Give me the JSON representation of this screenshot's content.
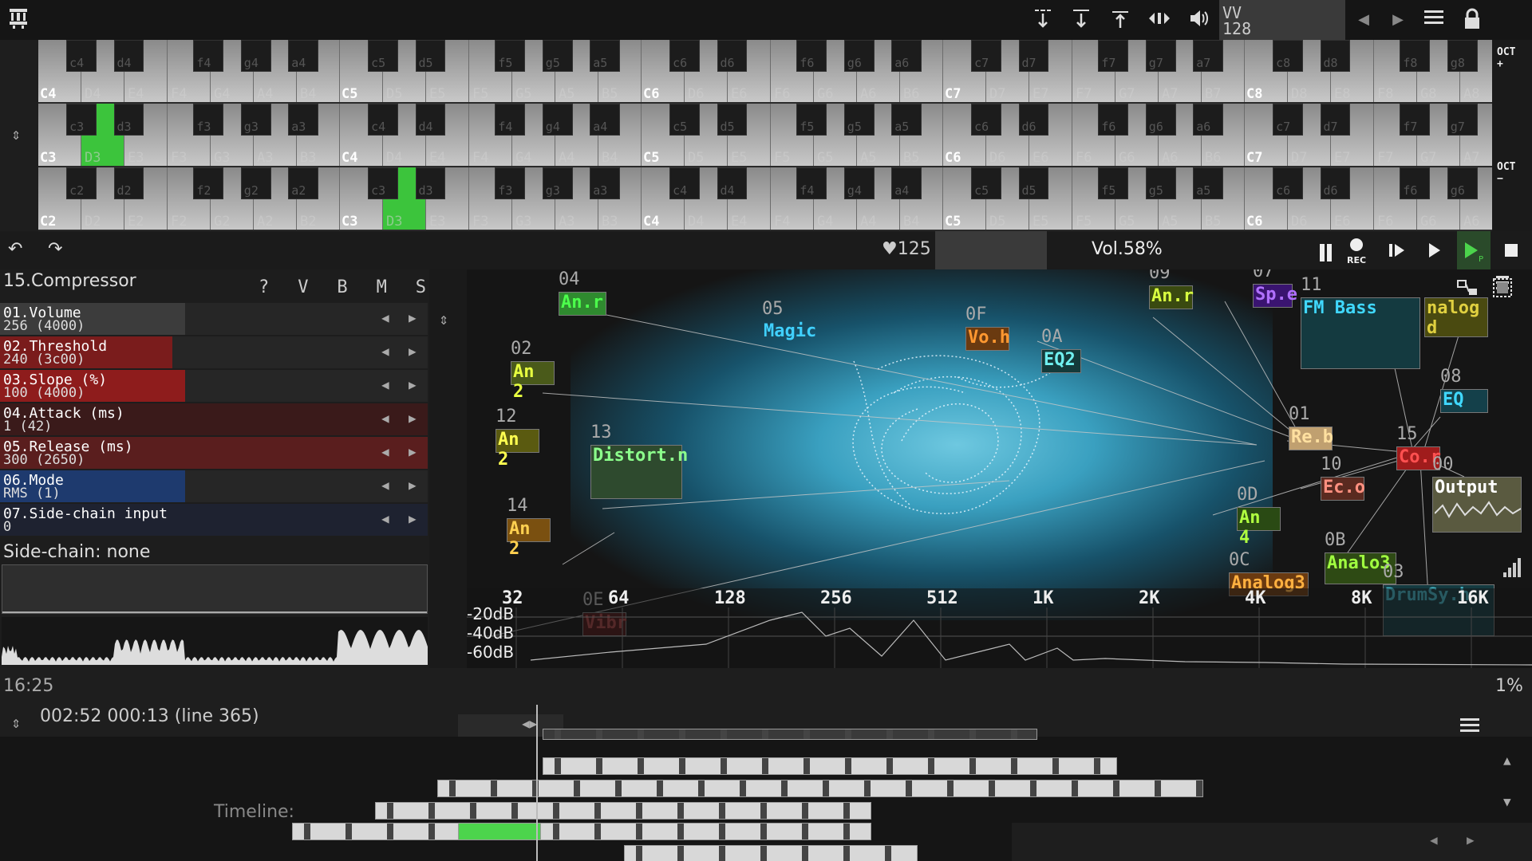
{
  "topbar": {
    "logo": "SunVox",
    "vv_label": "VV",
    "vv_value": "128",
    "icons": [
      "arrow-down-dashed-icon",
      "arrow-down-line-icon",
      "arrow-up-line-icon",
      "arrows-horizontal-icon",
      "speaker-icon",
      "chevron-left-icon",
      "chevron-right-icon",
      "menu-icon",
      "lock-icon"
    ],
    "oct_up": "OCT",
    "oct_down": "OCT"
  },
  "keyboard": {
    "rows": [
      {
        "octaves": [
          "C4",
          "C5",
          "C6",
          "C7",
          "C8"
        ]
      },
      {
        "octaves": [
          "C3",
          "C4",
          "C5",
          "C6",
          "C7"
        ]
      },
      {
        "octaves": [
          "C2",
          "C3",
          "C4",
          "C5",
          "C6"
        ]
      }
    ],
    "white_notes": [
      "D",
      "E",
      "F",
      "G",
      "A",
      "B"
    ],
    "black_notes": [
      "c",
      "d",
      "f",
      "g",
      "a"
    ]
  },
  "transport": {
    "bpm": "♥125",
    "volume": "Vol.58%",
    "rec": "REC"
  },
  "module_panel": {
    "title": "15.Compressor",
    "flags": [
      "?",
      "V",
      "B",
      "M",
      "S"
    ],
    "params": [
      {
        "name": "01.Volume",
        "value": "256 (4000)",
        "color": "#3c3c3c"
      },
      {
        "name": "02.Threshold",
        "value": "240 (3c00)",
        "color": "#7a1c1c"
      },
      {
        "name": "03.Slope (%)",
        "value": "100 (4000)",
        "color": "#8e1c1c"
      },
      {
        "name": "04.Attack (ms)",
        "value": "1 (42)",
        "color": "#3a1a1a"
      },
      {
        "name": "05.Release (ms)",
        "value": "300 (2650)",
        "color": "#5a1e1e"
      },
      {
        "name": "06.Mode",
        "value": "RMS (1)",
        "color": "#1e3a6e"
      },
      {
        "name": "07.Side-chain input",
        "value": "0",
        "color": "#1e2230"
      }
    ],
    "sidechain": "Side-chain: none"
  },
  "graph": {
    "nodes": [
      {
        "id": "04",
        "label": "An.r",
        "bg": "#2f8a2f",
        "fg": "#4cff4c"
      },
      {
        "id": "02",
        "label": "An 2",
        "bg": "#4a5a1a",
        "fg": "#e8ff40"
      },
      {
        "id": "12",
        "label": "An 2",
        "bg": "#5a5a10",
        "fg": "#ffff50"
      },
      {
        "id": "13",
        "label": "Distort.n",
        "bg": "#2e4a2e",
        "fg": "#8cff8c"
      },
      {
        "id": "14",
        "label": "An 2",
        "bg": "#7a5010",
        "fg": "#ffd050"
      },
      {
        "id": "05",
        "label": "Magic",
        "bg": "transparent",
        "fg": "#40d0ff"
      },
      {
        "id": "0F",
        "label": "Vo.h",
        "bg": "#6a3a10",
        "fg": "#ff9830"
      },
      {
        "id": "09",
        "label": "An.r",
        "bg": "#3a4a10",
        "fg": "#d8ff40"
      },
      {
        "id": "0A",
        "label": "EQ2",
        "bg": "#143a3a",
        "fg": "#70f0f0"
      },
      {
        "id": "07",
        "label": "Sp.e",
        "bg": "#3a1470",
        "fg": "#b070ff"
      },
      {
        "id": "11",
        "label": "FM Bass",
        "bg": "#143a40",
        "fg": "#40d8ff"
      },
      {
        "id": "",
        "label": "nalog d",
        "bg": "#4a4a10",
        "fg": "#e0d040"
      },
      {
        "id": "08",
        "label": "EQ",
        "bg": "#14404a",
        "fg": "#40d8ff"
      },
      {
        "id": "01",
        "label": "Re.b",
        "bg": "#c0a070",
        "fg": "#ffe0a0"
      },
      {
        "id": "15",
        "label": "Co.r",
        "bg": "#a01c1c",
        "fg": "#ff5050"
      },
      {
        "id": "00",
        "label": "Output",
        "bg": "#5a5a40",
        "fg": "#ffffff"
      },
      {
        "id": "10",
        "label": "Ec.o",
        "bg": "#5a2a20",
        "fg": "#ff9080"
      },
      {
        "id": "0D",
        "label": "An 4",
        "bg": "#2a4a14",
        "fg": "#b0ff40"
      },
      {
        "id": "0C",
        "label": "Analog3",
        "bg": "#6a3a10",
        "fg": "#ffb040"
      },
      {
        "id": "0B",
        "label": "Analo3",
        "bg": "#2e4a14",
        "fg": "#a0ff40"
      },
      {
        "id": "03",
        "label": "DrumSy.h",
        "bg": "#143a40",
        "fg": "#40b0c0"
      },
      {
        "id": "0E",
        "label": "Vibr",
        "bg": "#4a1414",
        "fg": "#a04040"
      }
    ],
    "freq_labels": [
      "32",
      "64",
      "128",
      "256",
      "512",
      "1K",
      "2K",
      "4K",
      "8K",
      "16K"
    ],
    "db_labels": [
      "-20dB",
      "-40dB",
      "-60dB"
    ]
  },
  "status": {
    "time_left": "16:25",
    "zoom": "1%"
  },
  "timeline": {
    "position": "002:52 000:13 (line 365)",
    "label": "Timeline:"
  }
}
